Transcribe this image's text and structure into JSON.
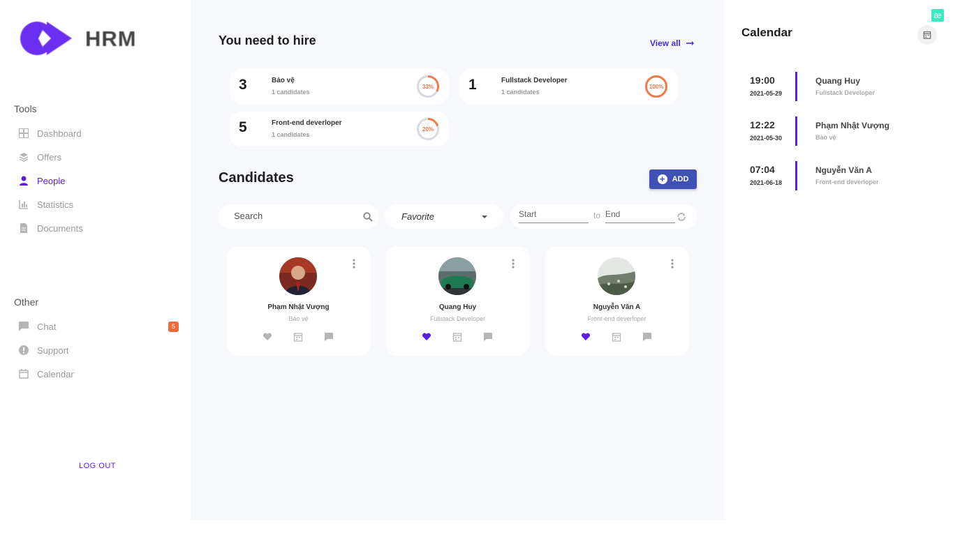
{
  "brand": {
    "name": "HRM",
    "logo_color": "#6a2ff0"
  },
  "sidebar": {
    "tools_title": "Tools",
    "tools": [
      {
        "label": "Dashboard",
        "icon": "grid-icon",
        "active": false
      },
      {
        "label": "Offers",
        "icon": "layers-icon",
        "active": false
      },
      {
        "label": "People",
        "icon": "person-icon",
        "active": true
      },
      {
        "label": "Statistics",
        "icon": "bar-chart-icon",
        "active": false
      },
      {
        "label": "Documents",
        "icon": "document-icon",
        "active": false
      }
    ],
    "other_title": "Other",
    "other": [
      {
        "label": "Chat",
        "icon": "chat-icon",
        "badge": "5"
      },
      {
        "label": "Support",
        "icon": "alert-icon"
      },
      {
        "label": "Calendar",
        "icon": "calendar-icon"
      }
    ],
    "logout": "LOG OUT",
    "accent": "#5a1ee0",
    "badge_color": "#f26a3c"
  },
  "hire": {
    "title": "You need to hire",
    "view_all": "View all",
    "cards": [
      {
        "count": "3",
        "role": "Bảo vệ",
        "candidates": "1 candidates",
        "percent": "33%",
        "fraction": 0.33
      },
      {
        "count": "1",
        "role": "Fullstack Developer",
        "candidates": "1 candidates",
        "percent": "100%",
        "fraction": 1.0
      },
      {
        "count": "5",
        "role": "Front-end deverloper",
        "candidates": "1 candidates",
        "percent": "20%",
        "fraction": 0.2
      }
    ],
    "ring_color": "#f07a4a"
  },
  "candidates": {
    "title": "Candidates",
    "add_label": "ADD",
    "search_placeholder": "Search",
    "filter_value": "Favorite",
    "start_placeholder": "Start",
    "to_label": "to",
    "end_placeholder": "End",
    "list": [
      {
        "name": "Phạm Nhật Vượng",
        "position": "Bảo vệ",
        "favorite": false
      },
      {
        "name": "Quang Huy",
        "position": "Fullstack Developer",
        "favorite": true
      },
      {
        "name": "Nguyễn Văn A",
        "position": "Front-end deverloper",
        "favorite": true
      }
    ]
  },
  "calendar": {
    "title": "Calendar",
    "badge": "æ",
    "events": [
      {
        "time": "19:00",
        "date": "2021-05-29",
        "name": "Quang Huy",
        "role": "Fullstack Developer"
      },
      {
        "time": "12:22",
        "date": "2021-05-30",
        "name": "Phạm Nhật Vượng",
        "role": "Bảo vệ"
      },
      {
        "time": "07:04",
        "date": "2021-06-18",
        "name": "Nguyễn Văn A",
        "role": "Front-end deverloper"
      }
    ]
  }
}
